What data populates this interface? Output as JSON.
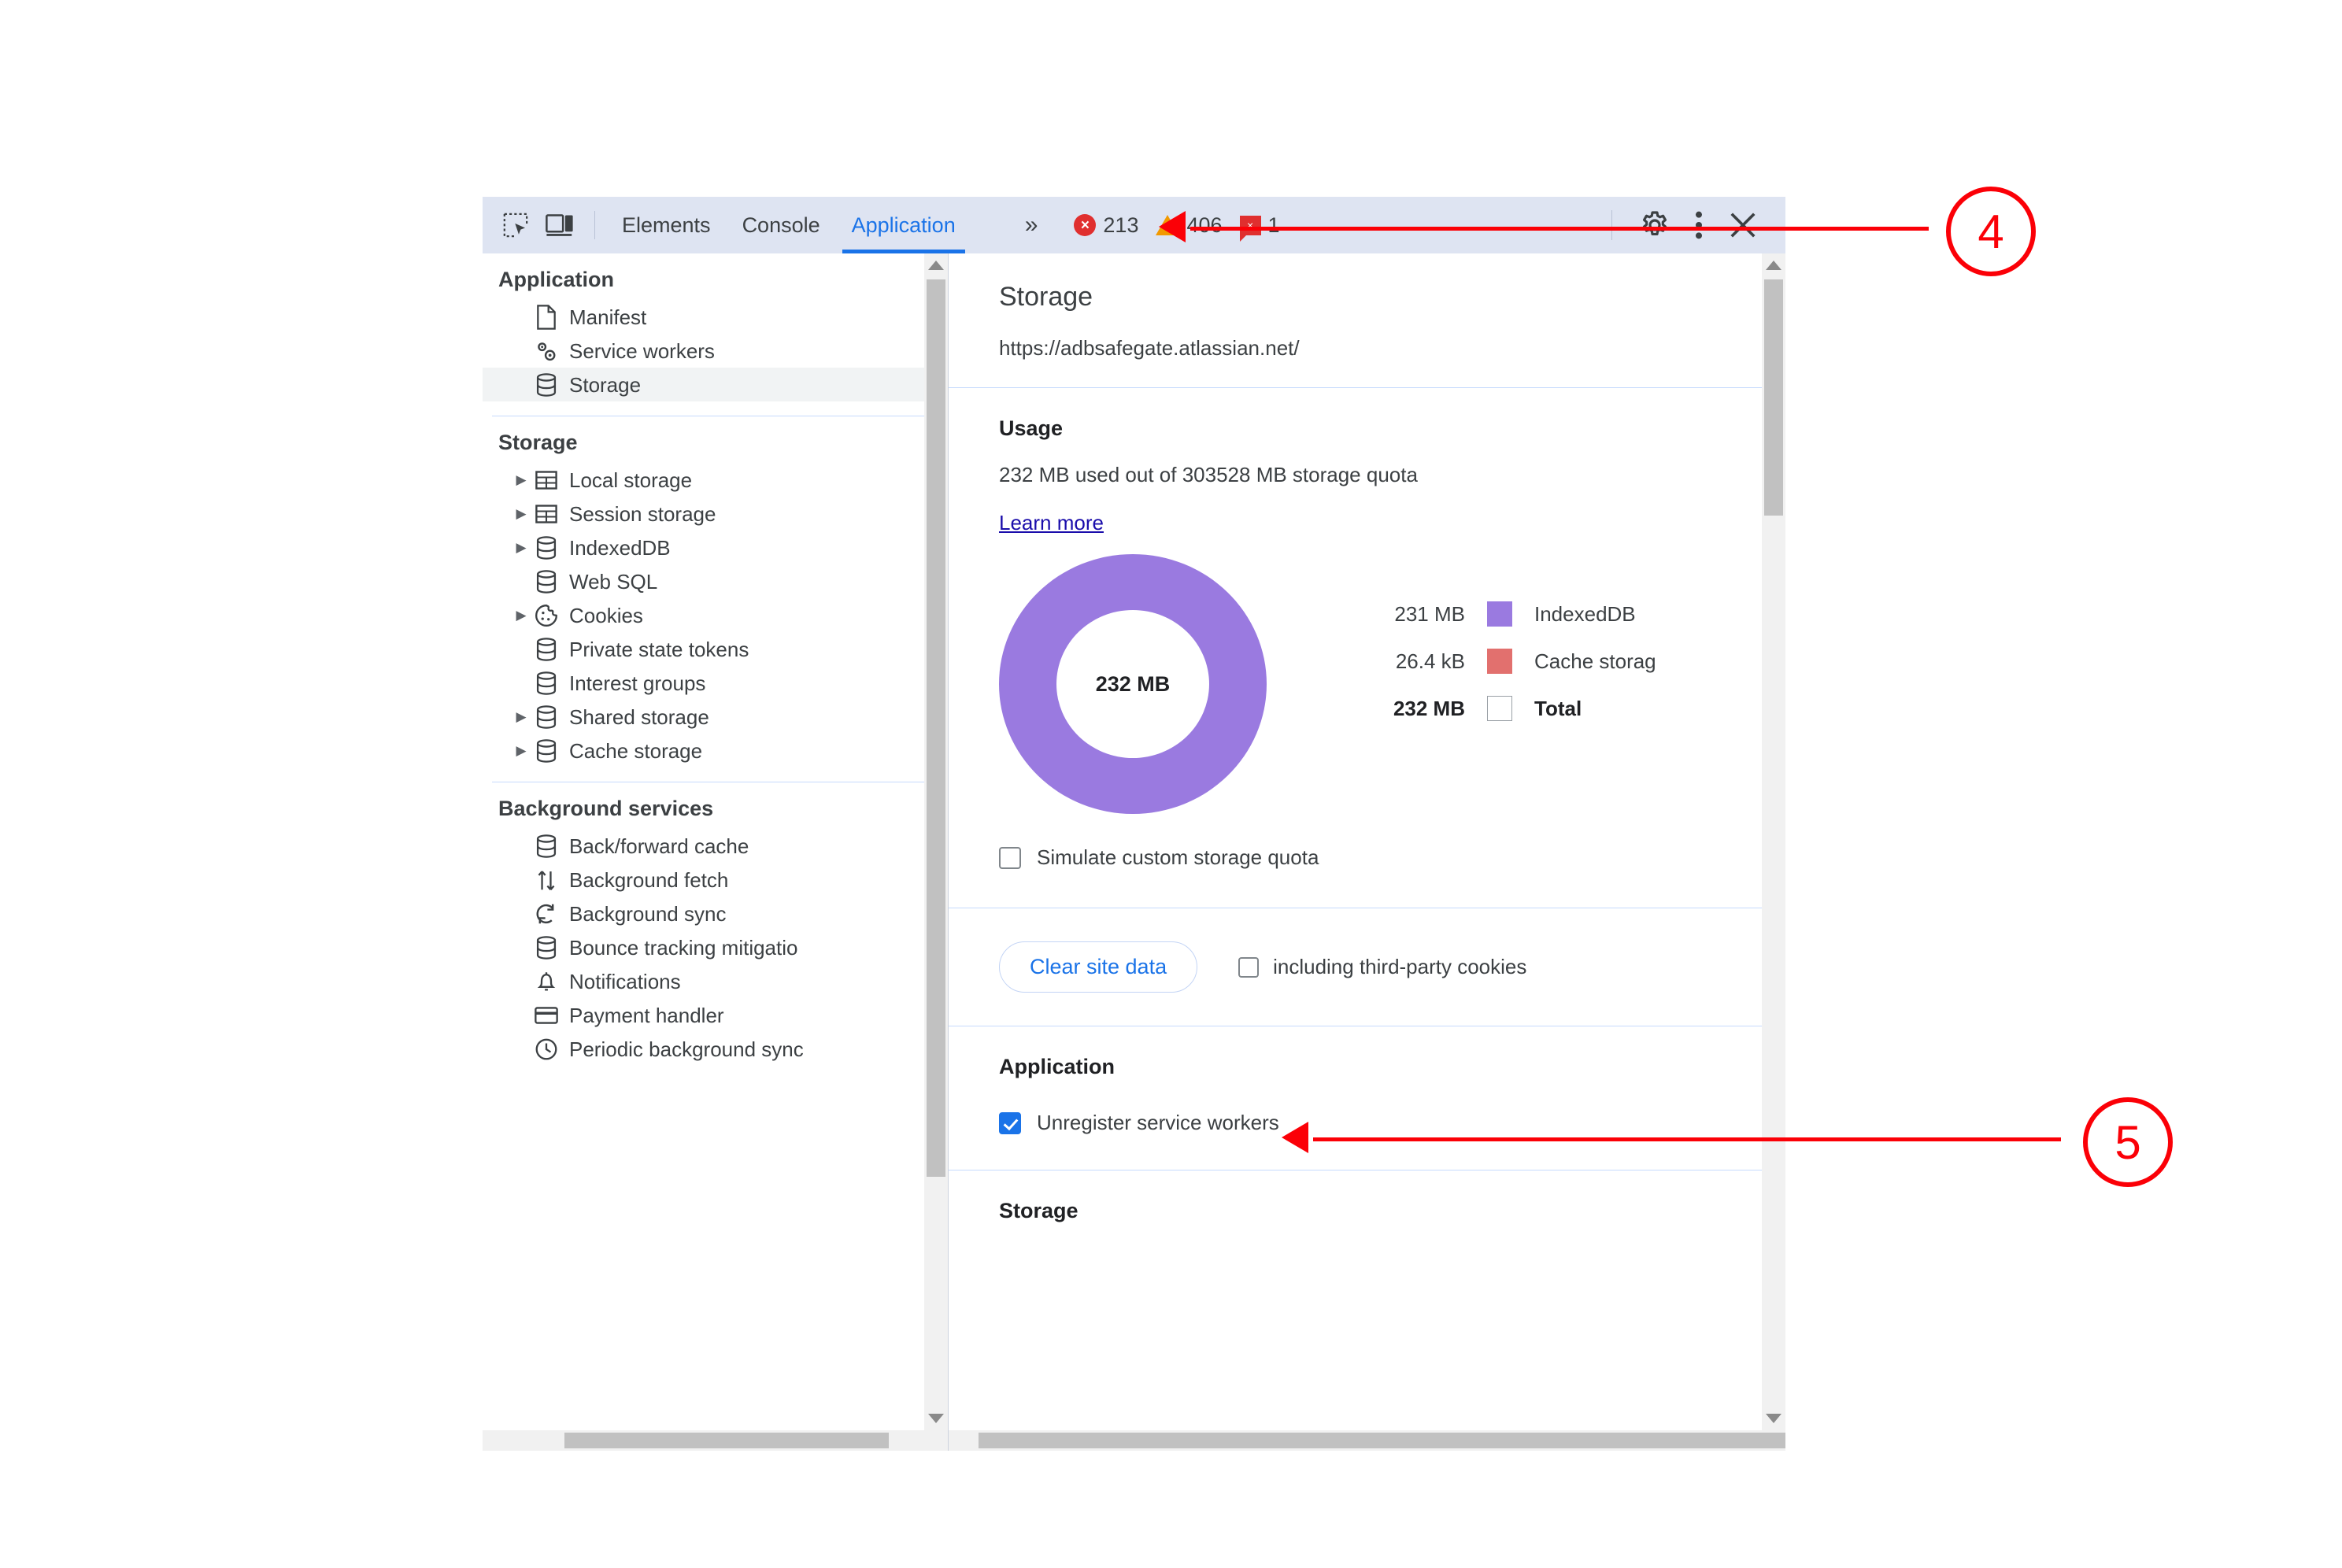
{
  "toolbar": {
    "icons": [
      {
        "name": "inspect-element-icon",
        "label": "Inspect element"
      },
      {
        "name": "device-toolbar-icon",
        "label": "Toggle device toolbar"
      }
    ],
    "tabs": [
      {
        "label": "Elements",
        "active": false
      },
      {
        "label": "Console",
        "active": false
      },
      {
        "label": "Application",
        "active": true
      }
    ],
    "more_tabs": "»",
    "counters": [
      {
        "kind": "errors",
        "icon": "error-circle-icon",
        "glyph": "×",
        "count": "213",
        "color": "#e02f2f"
      },
      {
        "kind": "warnings",
        "icon": "warning-triangle-icon",
        "glyph": "!",
        "count": "406",
        "color": "#f29900"
      },
      {
        "kind": "issues",
        "icon": "issue-flag-icon",
        "glyph": "×",
        "count": "1",
        "color": "#e02f2f"
      }
    ],
    "settings_label": "Settings",
    "menu_label": "Customize and control DevTools",
    "close_label": "Close DevTools"
  },
  "sidebar": {
    "sections": [
      {
        "title": "Application",
        "items": [
          {
            "label": "Manifest",
            "icon": "manifest-file-icon",
            "expandable": false,
            "selected": false
          },
          {
            "label": "Service workers",
            "icon": "service-workers-gears-icon",
            "expandable": false,
            "selected": false
          },
          {
            "label": "Storage",
            "icon": "database-icon",
            "expandable": false,
            "selected": true
          }
        ]
      },
      {
        "title": "Storage",
        "items": [
          {
            "label": "Local storage",
            "icon": "table-icon",
            "expandable": true,
            "selected": false
          },
          {
            "label": "Session storage",
            "icon": "table-icon",
            "expandable": true,
            "selected": false
          },
          {
            "label": "IndexedDB",
            "icon": "database-icon",
            "expandable": true,
            "selected": false
          },
          {
            "label": "Web SQL",
            "icon": "database-icon",
            "expandable": false,
            "selected": false
          },
          {
            "label": "Cookies",
            "icon": "cookie-icon",
            "expandable": true,
            "selected": false
          },
          {
            "label": "Private state tokens",
            "icon": "database-icon",
            "expandable": false,
            "selected": false
          },
          {
            "label": "Interest groups",
            "icon": "database-icon",
            "expandable": false,
            "selected": false
          },
          {
            "label": "Shared storage",
            "icon": "database-icon",
            "expandable": true,
            "selected": false
          },
          {
            "label": "Cache storage",
            "icon": "database-icon",
            "expandable": true,
            "selected": false
          }
        ]
      },
      {
        "title": "Background services",
        "items": [
          {
            "label": "Back/forward cache",
            "icon": "database-icon",
            "expandable": false,
            "selected": false
          },
          {
            "label": "Background fetch",
            "icon": "arrows-updown-icon",
            "expandable": false,
            "selected": false
          },
          {
            "label": "Background sync",
            "icon": "sync-icon",
            "expandable": false,
            "selected": false
          },
          {
            "label": "Bounce tracking mitigatio",
            "icon": "database-icon",
            "expandable": false,
            "selected": false
          },
          {
            "label": "Notifications",
            "icon": "bell-icon",
            "expandable": false,
            "selected": false
          },
          {
            "label": "Payment handler",
            "icon": "credit-card-icon",
            "expandable": false,
            "selected": false
          },
          {
            "label": "Periodic background sync",
            "icon": "clock-icon",
            "expandable": false,
            "selected": false
          }
        ]
      }
    ]
  },
  "main": {
    "title": "Storage",
    "url": "https://adbsafegate.atlassian.net/",
    "usage": {
      "heading": "Usage",
      "summary": "232 MB used out of 303528 MB storage quota",
      "learn_more": "Learn more",
      "donut_center": "232 MB",
      "simulate_quota_label": "Simulate custom storage quota",
      "simulate_quota_checked": false
    },
    "clear": {
      "button_label": "Clear site data",
      "third_party_label": "including third-party cookies",
      "third_party_checked": false
    },
    "application_section": {
      "heading": "Application",
      "unregister_label": "Unregister service workers",
      "unregister_checked": true
    },
    "storage_section": {
      "heading": "Storage"
    }
  },
  "chart_data": {
    "type": "pie",
    "title": "Usage",
    "center_label": "232 MB",
    "categories": [
      "IndexedDB",
      "Cache storage",
      "Total"
    ],
    "labels": [
      "231 MB",
      "26.4 kB",
      "232 MB"
    ],
    "values": [
      231,
      0.0264,
      232
    ],
    "units": "MB",
    "colors": [
      "#9a7ae0",
      "#e2706e",
      "#ffffff"
    ],
    "legend_position": "right",
    "legend": [
      {
        "value": "231 MB",
        "name": "IndexedDB",
        "color": "#9a7ae0",
        "bold": false
      },
      {
        "value": "26.4 kB",
        "name": "Cache storag",
        "color": "#e2706e",
        "bold": false
      },
      {
        "value": "232 MB",
        "name": "Total",
        "color": "#ffffff",
        "bold": true
      }
    ]
  },
  "annotations": [
    {
      "number": "4",
      "target": "application-tab"
    },
    {
      "number": "5",
      "target": "clear-site-data-button"
    }
  ],
  "colors": {
    "accent_blue": "#1a73e8",
    "toolbar_bg": "#dee4f2",
    "annotation_red": "#fb0007",
    "indexeddb_purple": "#9a7ae0",
    "cache_red": "#e2706e"
  }
}
